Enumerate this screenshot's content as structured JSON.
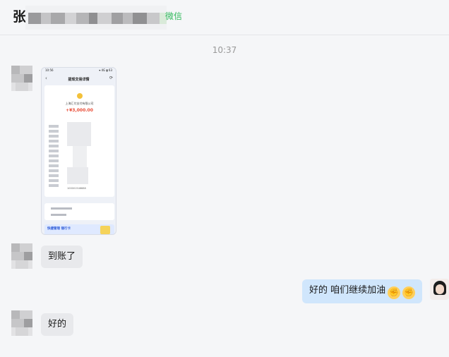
{
  "header": {
    "title_first_char": "张",
    "source_tag": "微信"
  },
  "chat": {
    "timestamp": "10:37",
    "messages": [
      {
        "side": "in",
        "type": "image"
      },
      {
        "side": "in",
        "type": "text",
        "text": "到账了"
      },
      {
        "side": "out",
        "type": "text",
        "text": "好的 咱们继续加油",
        "emojis": [
          "✊",
          "✊"
        ]
      },
      {
        "side": "in",
        "type": "text",
        "text": "好的"
      }
    ]
  },
  "screenshot_image": {
    "status_time": "10:56",
    "status_right": "▾ 4G ▮ 63",
    "title": "提现交易详情",
    "back_icon": "‹",
    "share_icon": "⟳",
    "merchant": "上海汇付支付有限公司",
    "amount": "+¥3,000.00",
    "order_id": "100001546688",
    "banner_title": "快捷管理 银行卡"
  },
  "colors": {
    "incoming_bubble": "#e8e9ec",
    "outgoing_bubble": "#d0e6fc",
    "source_tag": "#2fb85a",
    "amount_red": "#e94b35"
  }
}
